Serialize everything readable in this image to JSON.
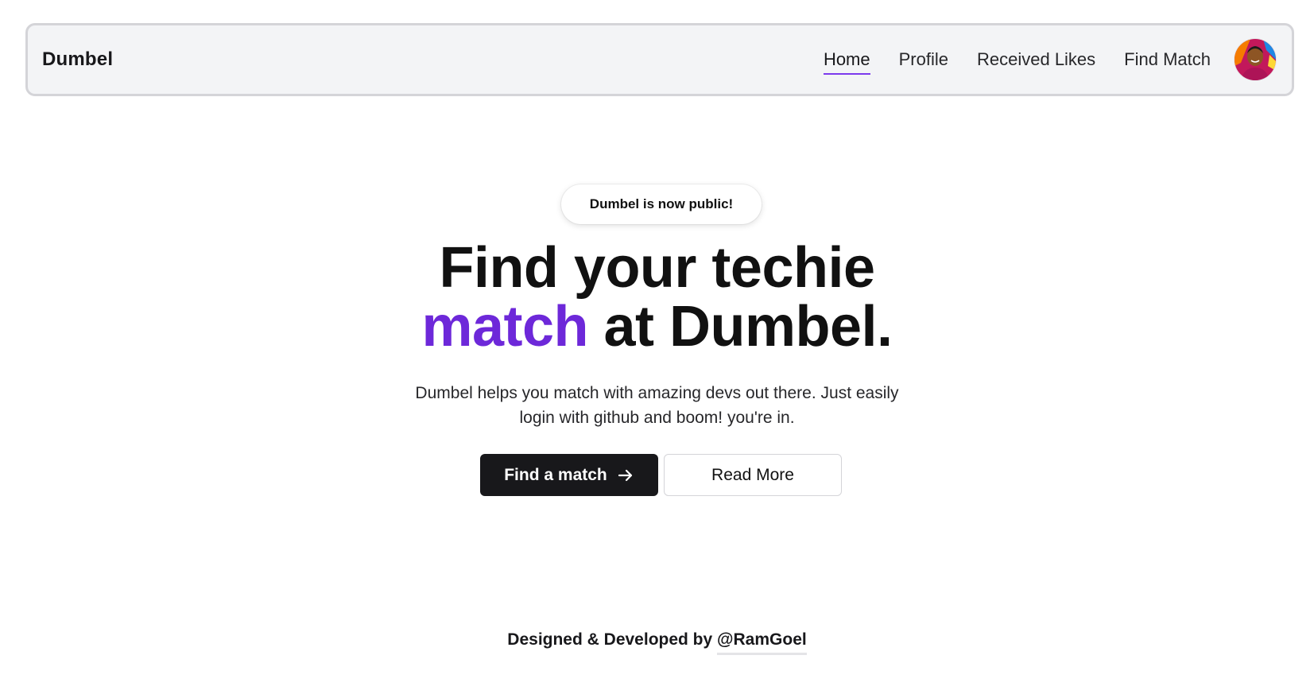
{
  "brand": {
    "name": "Dumbel"
  },
  "nav": {
    "items": [
      {
        "label": "Home",
        "active": true
      },
      {
        "label": "Profile",
        "active": false
      },
      {
        "label": "Received Likes",
        "active": false
      },
      {
        "label": "Find Match",
        "active": false
      }
    ],
    "avatar_icon": "user-avatar"
  },
  "hero": {
    "badge": "Dumbel is now public!",
    "headline_line1": "Find your techie",
    "headline_accent": "match",
    "headline_line2_rest": " at Dumbel.",
    "subtext": "Dumbel helps you match with amazing devs out there. Just easily login with github and boom! you're in.",
    "primary_button": "Find a match",
    "primary_button_icon": "arrow-right-icon",
    "secondary_button": "Read More"
  },
  "footer": {
    "prefix": "Designed & Developed by ",
    "handle": "@RamGoel"
  },
  "colors": {
    "accent": "#6d28d9",
    "primary_button_bg": "#18181b",
    "navbar_bg": "#f3f4f6"
  }
}
